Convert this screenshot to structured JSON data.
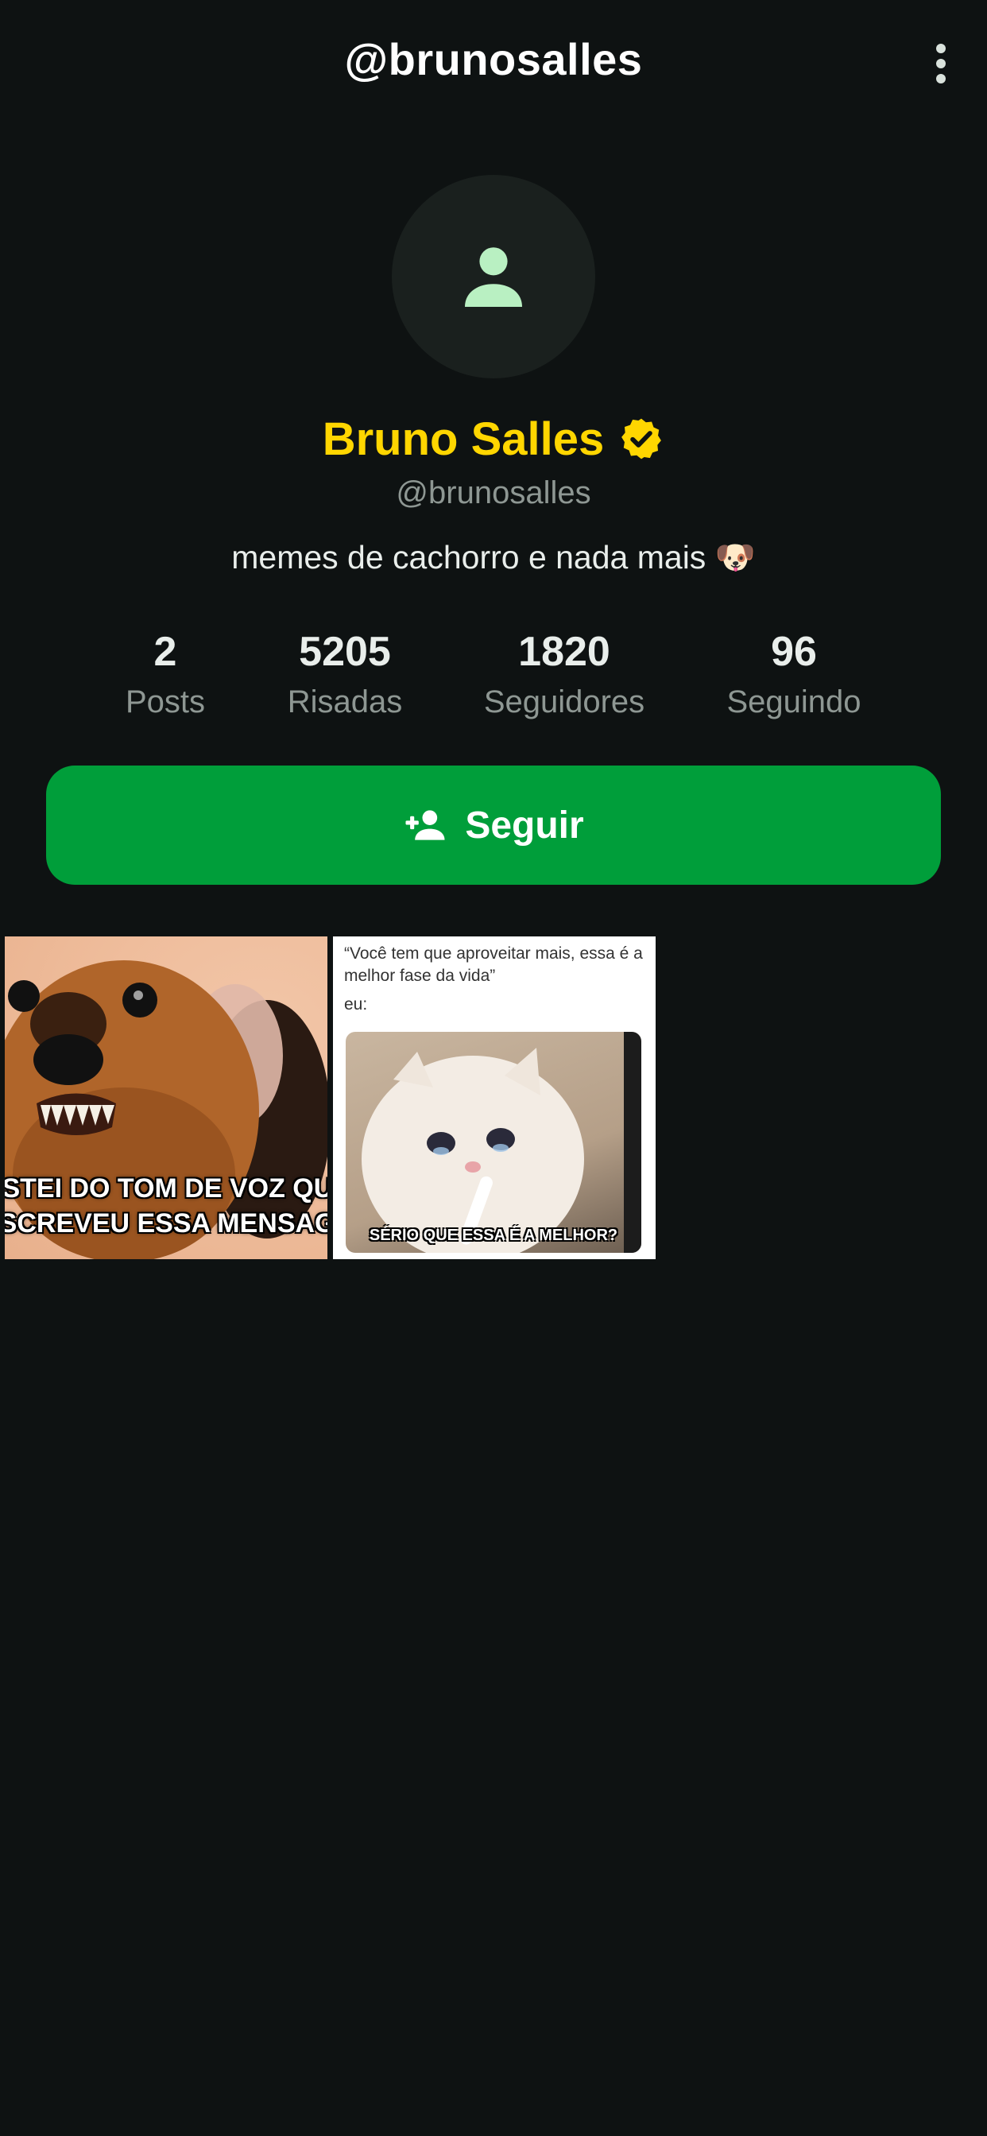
{
  "header": {
    "title": "@brunosalles",
    "more_icon": "more-vertical-icon"
  },
  "profile": {
    "avatar_icon": "person-icon",
    "display_name": "Bruno Salles",
    "verified_icon": "verified-badge-icon",
    "username": "@brunosalles",
    "bio": "memes de cachorro e nada mais 🐶"
  },
  "stats": [
    {
      "value": "2",
      "label": "Posts"
    },
    {
      "value": "5205",
      "label": "Risadas"
    },
    {
      "value": "1820",
      "label": "Seguidores"
    },
    {
      "value": "96",
      "label": "Seguindo"
    }
  ],
  "follow_button": {
    "label": "Seguir",
    "icon": "person-add-icon"
  },
  "posts": [
    {
      "caption_line1": "OSTEI DO TOM DE VOZ QUE",
      "caption_line2": "ESCREVEU ESSA MENSAGEM"
    },
    {
      "caption": "“Você tem que aproveitar mais, essa é a melhor fase da vida”",
      "sub": "eu:",
      "image_text": "SÉRIO QUE ESSA É A MELHOR?"
    }
  ],
  "colors": {
    "background": "#0e1212",
    "accent_yellow": "#ffd600",
    "follow_green": "#009e3a",
    "avatar_icon_green": "#b9f0c2",
    "muted_text": "#8e9793"
  }
}
